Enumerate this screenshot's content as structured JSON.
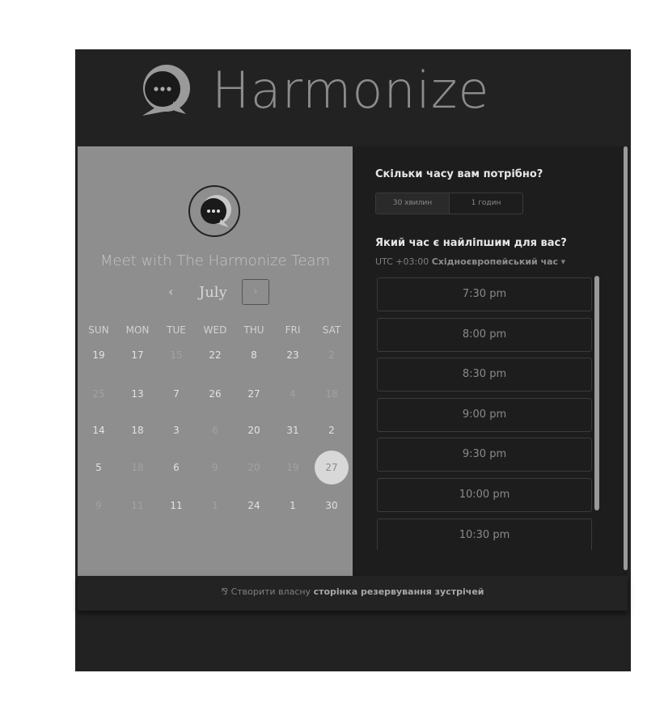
{
  "header": {
    "brand": "Harmonize"
  },
  "calendar": {
    "title": "Meet with The Harmonize Team",
    "month": "July",
    "prev_label": "‹",
    "next_label": "›",
    "weekdays": [
      "SUN",
      "MON",
      "TUE",
      "WED",
      "THU",
      "FRI",
      "SAT"
    ],
    "weeks": [
      [
        {
          "d": "19",
          "s": "available"
        },
        {
          "d": "17",
          "s": "available"
        },
        {
          "d": "15",
          "s": "unavailable"
        },
        {
          "d": "22",
          "s": "available"
        },
        {
          "d": "8",
          "s": "available"
        },
        {
          "d": "23",
          "s": "available"
        },
        {
          "d": "2",
          "s": "unavailable"
        }
      ],
      [
        {
          "d": "25",
          "s": "unavailable"
        },
        {
          "d": "13",
          "s": "available"
        },
        {
          "d": "7",
          "s": "available"
        },
        {
          "d": "26",
          "s": "available"
        },
        {
          "d": "27",
          "s": "available"
        },
        {
          "d": "4",
          "s": "unavailable"
        },
        {
          "d": "18",
          "s": "unavailable"
        }
      ],
      [
        {
          "d": "14",
          "s": "available"
        },
        {
          "d": "18",
          "s": "available"
        },
        {
          "d": "3",
          "s": "available"
        },
        {
          "d": "6",
          "s": "unavailable"
        },
        {
          "d": "20",
          "s": "available"
        },
        {
          "d": "31",
          "s": "available"
        },
        {
          "d": "2",
          "s": "available"
        }
      ],
      [
        {
          "d": "5",
          "s": "available"
        },
        {
          "d": "18",
          "s": "unavailable"
        },
        {
          "d": "6",
          "s": "available"
        },
        {
          "d": "9",
          "s": "unavailable"
        },
        {
          "d": "20",
          "s": "unavailable"
        },
        {
          "d": "19",
          "s": "unavailable"
        },
        {
          "d": "27",
          "s": "selected"
        }
      ],
      [
        {
          "d": "9",
          "s": "unavailable"
        },
        {
          "d": "11",
          "s": "unavailable"
        },
        {
          "d": "11",
          "s": "available"
        },
        {
          "d": "1",
          "s": "unavailable"
        },
        {
          "d": "24",
          "s": "available"
        },
        {
          "d": "1",
          "s": "available"
        },
        {
          "d": "30",
          "s": "available"
        }
      ]
    ]
  },
  "booking": {
    "duration_question": "Скільки часу вам потрібно?",
    "durations": [
      {
        "label": "30 хвилин",
        "selected": true
      },
      {
        "label": "1 годин",
        "selected": false
      }
    ],
    "time_question": "Який час є найліпшим для вас?",
    "timezone_offset": "UTC +03:00",
    "timezone_name": "Східноєвропейський час",
    "timezone_caret": "▾",
    "slots": [
      "7:30 pm",
      "8:00 pm",
      "8:30 pm",
      "9:00 pm",
      "9:30 pm",
      "10:00 pm",
      "10:30 pm"
    ]
  },
  "footer": {
    "icon": "sprocket-icon",
    "glyph": "⅋",
    "prefix": "Створити власну",
    "link": "сторінка резервування зустрічей"
  }
}
